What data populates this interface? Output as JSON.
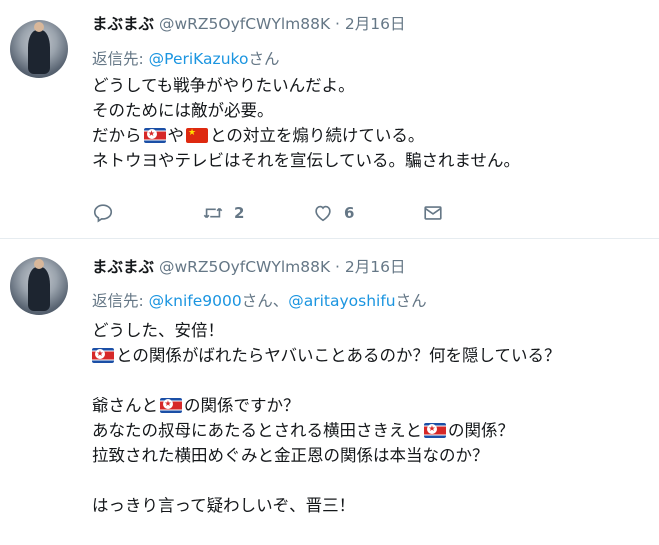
{
  "tweets": [
    {
      "name": "まぶまぶ",
      "handle": "@wRZ5OyfCWYlm88K",
      "separator": " · ",
      "date": "2月16日",
      "reply_prefix": "返信先: ",
      "reply_mentions": [
        "@PeriKazuko"
      ],
      "reply_suffixes": [
        "さん"
      ],
      "lines": [
        "どうしても戦争がやりたいんだよ。",
        "そのためには敵が必要。",
        "だから",
        "や",
        "との対立を煽り続けている。",
        "ネトウヨやテレビはそれを宣伝している。騙されません。"
      ],
      "retweets": "2",
      "likes": "6"
    },
    {
      "name": "まぶまぶ",
      "handle": "@wRZ5OyfCWYlm88K",
      "separator": " · ",
      "date": "2月16日",
      "reply_prefix": "返信先: ",
      "reply_mentions": [
        "@knife9000",
        "@aritayoshifu"
      ],
      "reply_suffixes": [
        "さん、",
        "さん"
      ],
      "lines": [
        "どうした、安倍！",
        "との関係がばれたらヤバいことあるのか？何を隠している？",
        "爺さんと",
        "の関係ですか？",
        "あなたの叔母にあたるとされる横田さきえと",
        "の関係？",
        "拉致された横田めぐみと金正恩の関係は本当なのか？",
        "はっきり言って疑わしいぞ、晋三！"
      ]
    }
  ],
  "icons": {
    "flag_north_korea": "flag-kp-icon",
    "flag_china": "flag-cn-icon",
    "reply": "reply-icon",
    "retweet": "retweet-icon",
    "like": "heart-icon",
    "dm": "envelope-icon"
  },
  "colors": {
    "link": "#1b95e0",
    "muted": "#657786",
    "text": "#14171a",
    "divider": "#e6ecf0"
  }
}
